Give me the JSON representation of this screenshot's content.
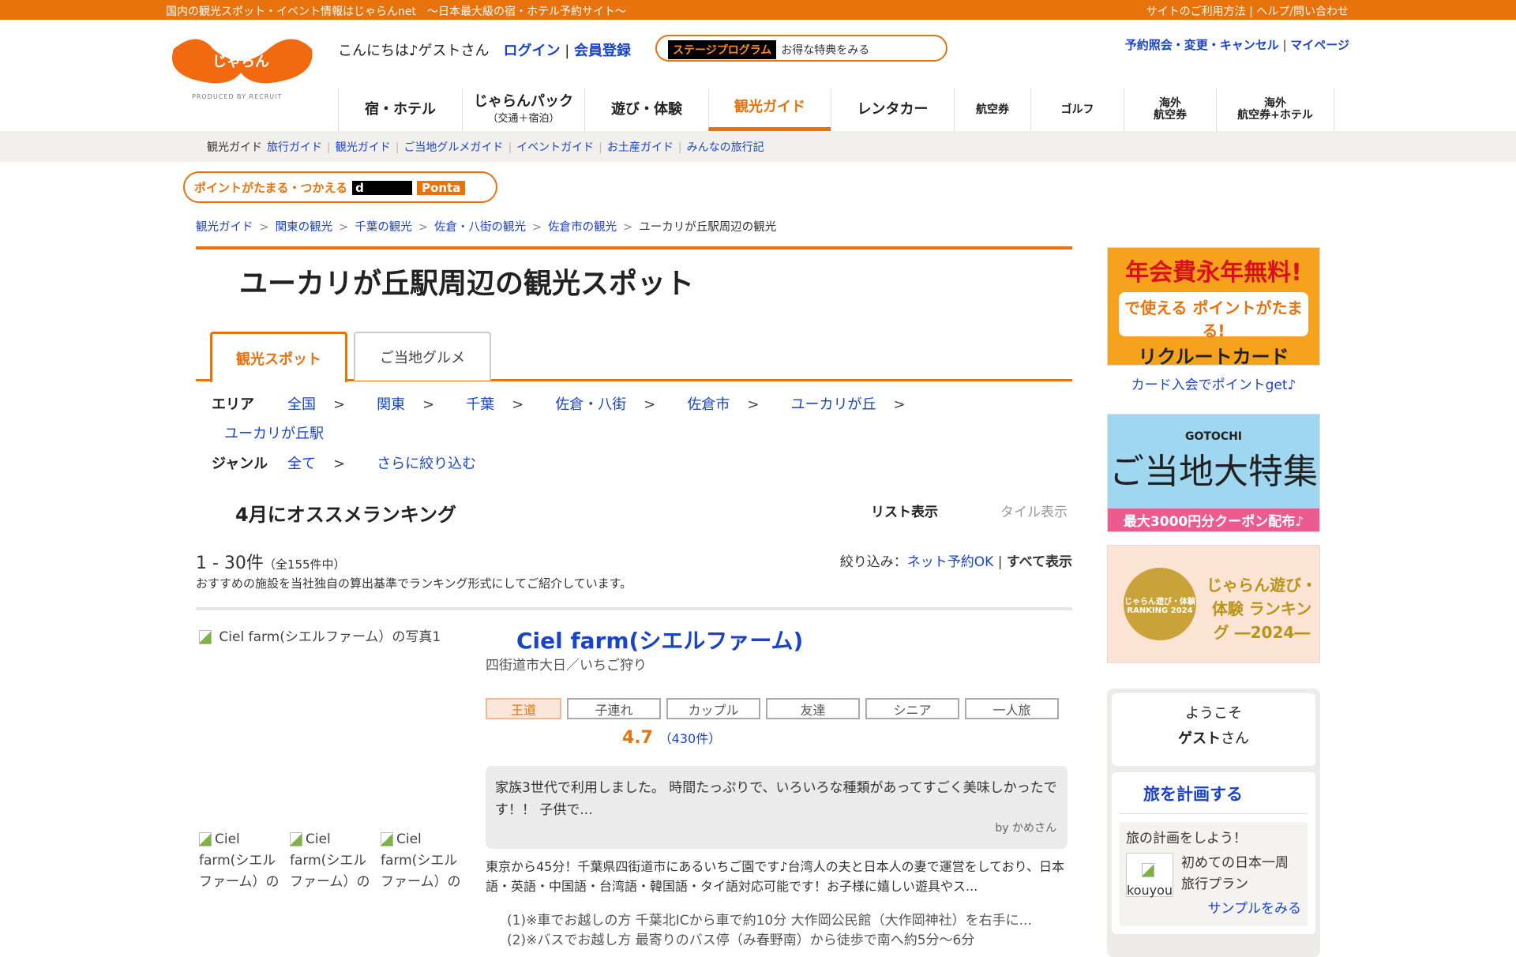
{
  "topbar": {
    "tagline": "国内の観光スポット・イベント情報はじゃらんnet　～日本最大級の宿・ホテル予約サイト～",
    "links": "サイトのご利用方法 | ヘルプ/問い合わせ"
  },
  "header": {
    "logo": "じゃらん",
    "produced": "PRODUCED BY RECRUIT",
    "greeting": "こんにちは♪ゲストさん",
    "login": "ログイン",
    "register": "会員登録",
    "stage_label": "ステージプログラム",
    "stage_text": "お得な特典をみる",
    "reserve": "予約照会・変更・キャンセル",
    "mypage": "マイページ"
  },
  "nav": [
    {
      "label": "宿・ホテル",
      "w": 157
    },
    {
      "label": "じゃらんパック",
      "sub": "（交通＋宿泊）",
      "w": 155
    },
    {
      "label": "遊び・体験",
      "w": 157
    },
    {
      "label": "観光ガイド",
      "w": 155,
      "active": true
    },
    {
      "label": "レンタカー",
      "w": 156
    },
    {
      "label": "航空券",
      "w": 97,
      "small": true
    },
    {
      "label": "ゴルフ",
      "w": 118,
      "small": true
    },
    {
      "label": "海外\n航空券",
      "w": 117,
      "small": true
    },
    {
      "label": "海外\n航空券+ホテル",
      "w": 150,
      "small": true
    }
  ],
  "subnav": {
    "current": "観光ガイド",
    "links": [
      "旅行ガイド",
      "観光ガイド",
      "ご当地グルメガイド",
      "イベントガイド",
      "お土産ガイド",
      "みんなの旅行記"
    ]
  },
  "points": {
    "label": "ポイントがたまる・つかえる",
    "d": "d",
    "ponta": "Ponta"
  },
  "breadcrumb": [
    "観光ガイド",
    "関東の観光",
    "千葉の観光",
    "佐倉・八街の観光",
    "佐倉市の観光"
  ],
  "breadcrumb_current": "ユーカリが丘駅周辺の観光",
  "page_title": "ユーカリが丘駅周辺の観光スポット",
  "tabs": [
    "観光スポット",
    "ご当地グルメ"
  ],
  "area": {
    "label": "エリア",
    "links": [
      "全国",
      "関東",
      "千葉",
      "佐倉・八街",
      "佐倉市",
      "ユーカリが丘"
    ],
    "last": "ユーカリが丘駅"
  },
  "genre": {
    "label": "ジャンル",
    "all": "全て",
    "more": "さらに絞り込む"
  },
  "ranking": {
    "heading": "4月にオススメランキング",
    "list_view": "リスト表示",
    "tile_view": "タイル表示",
    "count": "1 - 30件",
    "total": "（全155件中）",
    "filter_label": "絞り込み：",
    "filter_net": "ネット予約OK",
    "filter_all": "すべて表示",
    "desc": "おすすめの施設を当社独自の算出基準でランキング形式にしてご紹介しています。"
  },
  "item": {
    "image_alt": "Ciel farm(シエルファーム）の写真1",
    "title": "Ciel farm(シエルファーム)",
    "sub": "四街道市大日／いちご狩り",
    "tags": [
      "王道",
      "子連れ",
      "カップル",
      "友達",
      "シニア",
      "一人旅"
    ],
    "rating": "4.7",
    "reviews": "（430件）",
    "review_text": "家族3世代で利用しました。 時間たっぷりで、いろいろな種類があってすごく美味しかったです！！ 子供で...",
    "review_by": "by かめさん",
    "description": "東京から45分！千葉県四街道市にあるいちご園です♪台湾人の夫と日本人の妻で運営をしており、日本語・英語・中国語・台湾語・韓国語・タイ語対応可能です！お子様に嬉しい遊具やス...",
    "access1": "(1)※車でお越しの方 千葉北ICから車で約10分 大作岡公民館（大作岡神社）を右手に...",
    "access2": "(2)※バスでお越し方 最寄りのバス停（み春野南）から徒歩で南へ約5分～6分",
    "thumb_alt": "Ciel farm(シエルファーム）の"
  },
  "sidebar": {
    "b1_head": "年会費永年無料!",
    "b1_mid": "で使える ポイントがたまる!",
    "b1_foot": "リクルートカード",
    "b1_link": "カード入会でポイントget♪",
    "b2_en": "GOTOCHI",
    "b2_head": "ご当地大特集",
    "b2_foot": "最大3000円分クーポン配布♪",
    "b3_medal": "じゃらん遊び・体験 RANKING 2024",
    "b3_text": "じゃらん遊び・体験 ランキング ―2024―",
    "welcome1": "ようこそ",
    "welcome_name": "ゲスト",
    "welcome_san": "さん",
    "plan_title": "旅を計画する",
    "plan_sub": "旅の計画をしよう！",
    "plan_img": "kouyou",
    "plan_item": "初めての日本一周旅行プラン",
    "plan_more": "サンプルをみる"
  },
  "colors": {
    "brand": "#e8720c",
    "link": "#1a44c8"
  }
}
